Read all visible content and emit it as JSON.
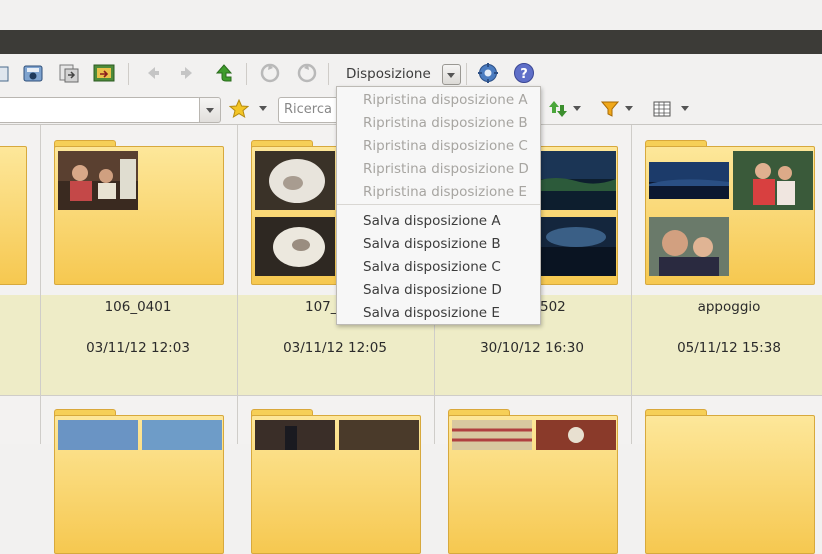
{
  "toolbar": {
    "disposizione_label": "Disposizione",
    "icons": [
      "photo-add-icon",
      "camera-import-icon",
      "export-icon",
      "slideshow-icon",
      "back-arrow-icon",
      "forward-arrow-icon",
      "up-arrow-icon",
      "rotate-left-icon",
      "rotate-right-icon",
      "settings-gear-icon",
      "help-icon"
    ]
  },
  "location": {
    "search_placeholder": "Ricerca"
  },
  "menu": {
    "restore_items": [
      "Ripristina disposizione A",
      "Ripristina disposizione B",
      "Ripristina disposizione C",
      "Ripristina disposizione D",
      "Ripristina disposizione E"
    ],
    "save_items": [
      "Salva disposizione A",
      "Salva disposizione B",
      "Salva disposizione C",
      "Salva disposizione D",
      "Salva disposizione E"
    ]
  },
  "folders": [
    {
      "name": "",
      "date": ""
    },
    {
      "name": "106_0401",
      "date": "03/11/12 12:03"
    },
    {
      "name": "107_",
      "date": "03/11/12 12:05"
    },
    {
      "name": "502",
      "date": "30/10/12 16:30"
    },
    {
      "name": "appoggio",
      "date": "05/11/12 15:38"
    }
  ],
  "colors": {
    "accent_folder": "#f6c850",
    "info_band": "#eeecc7",
    "dark_bar": "#3c3b37"
  }
}
